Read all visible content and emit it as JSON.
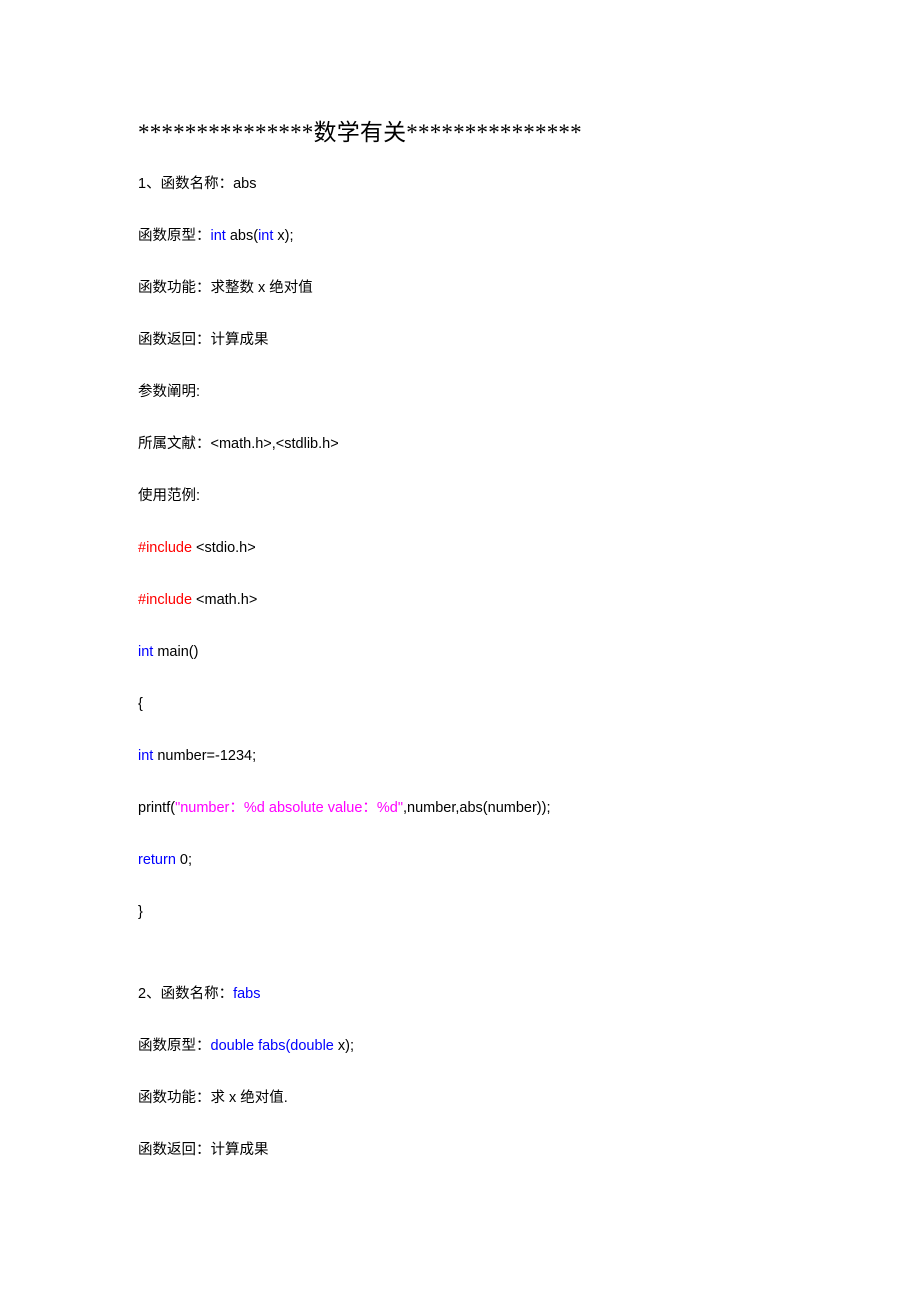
{
  "document": {
    "title": "***************数学有关***************",
    "title_prefix_asterisks": "***************",
    "title_core": "数学有关",
    "title_suffix_asterisks": "***************",
    "colors": {
      "text": "#000000",
      "keyword_blue": "#0000ff",
      "preprocessor_red": "#ff0000",
      "string_magenta": "#ff00ff",
      "background": "#ffffff"
    },
    "sections": [
      {
        "index": "1",
        "name_label": "1、函数名称：abs",
        "lines": [
          {
            "id": "s1-name",
            "parts": [
              {
                "text": "1、函数名称：abs",
                "color": "text"
              }
            ]
          },
          {
            "id": "s1-prototype",
            "parts": [
              {
                "text": "函数原型：",
                "color": "text"
              },
              {
                "text": "int",
                "color": "keyword_blue"
              },
              {
                "text": " abs(",
                "color": "text"
              },
              {
                "text": "int",
                "color": "keyword_blue"
              },
              {
                "text": " x);",
                "color": "text"
              }
            ]
          },
          {
            "id": "s1-function",
            "parts": [
              {
                "text": "函数功能：求整数 x 绝对值",
                "color": "text"
              }
            ]
          },
          {
            "id": "s1-return",
            "parts": [
              {
                "text": "函数返回：计算成果",
                "color": "text"
              }
            ]
          },
          {
            "id": "s1-params",
            "parts": [
              {
                "text": "参数阐明:",
                "color": "text"
              }
            ]
          },
          {
            "id": "s1-headers",
            "parts": [
              {
                "text": "所属文献：<math.h>,<stdlib.h>",
                "color": "text"
              }
            ]
          },
          {
            "id": "s1-example-label",
            "parts": [
              {
                "text": "使用范例:",
                "color": "text"
              }
            ]
          },
          {
            "id": "s1-code-1",
            "parts": [
              {
                "text": "#include",
                "color": "preprocessor_red"
              },
              {
                "text": " <stdio.h>",
                "color": "text"
              }
            ]
          },
          {
            "id": "s1-code-2",
            "parts": [
              {
                "text": "#include",
                "color": "preprocessor_red"
              },
              {
                "text": " <math.h>",
                "color": "text"
              }
            ]
          },
          {
            "id": "s1-code-3",
            "parts": [
              {
                "text": "int",
                "color": "keyword_blue"
              },
              {
                "text": " main()",
                "color": "text"
              }
            ]
          },
          {
            "id": "s1-code-4",
            "parts": [
              {
                "text": "{",
                "color": "text"
              }
            ]
          },
          {
            "id": "s1-code-5",
            "parts": [
              {
                "text": "int",
                "color": "keyword_blue"
              },
              {
                "text": " number=-1234;",
                "color": "text"
              }
            ]
          },
          {
            "id": "s1-code-6",
            "parts": [
              {
                "text": "printf(",
                "color": "text"
              },
              {
                "text": "\"number：%d absolute value：%d\"",
                "color": "string_magenta"
              },
              {
                "text": ",number,abs(number));",
                "color": "text"
              }
            ]
          },
          {
            "id": "s1-code-7",
            "parts": [
              {
                "text": "return",
                "color": "keyword_blue"
              },
              {
                "text": " 0;",
                "color": "text"
              }
            ]
          },
          {
            "id": "s1-code-8",
            "parts": [
              {
                "text": "}",
                "color": "text"
              }
            ]
          }
        ]
      },
      {
        "index": "2",
        "name_label": "2、函数名称：fabs",
        "lines": [
          {
            "id": "s2-name",
            "parts": [
              {
                "text": "2、函数名称：",
                "color": "text"
              },
              {
                "text": "fabs",
                "color": "keyword_blue"
              }
            ]
          },
          {
            "id": "s2-prototype",
            "parts": [
              {
                "text": "函数原型：",
                "color": "text"
              },
              {
                "text": "double fabs(double",
                "color": "keyword_blue"
              },
              {
                "text": " x);",
                "color": "text"
              }
            ]
          },
          {
            "id": "s2-function",
            "parts": [
              {
                "text": "函数功能：求 x 绝对值.",
                "color": "text"
              }
            ]
          },
          {
            "id": "s2-return",
            "parts": [
              {
                "text": "函数返回：计算成果",
                "color": "text"
              }
            ]
          }
        ]
      }
    ]
  }
}
